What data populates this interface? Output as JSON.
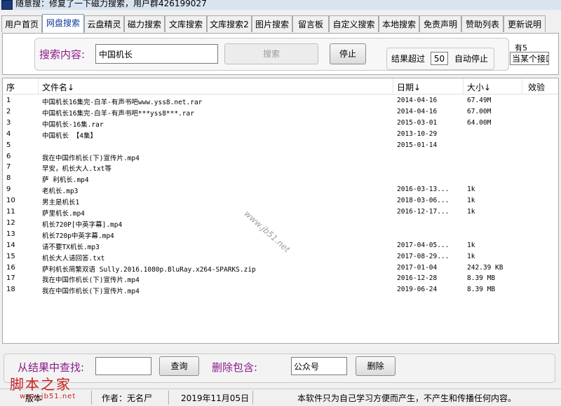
{
  "window": {
    "title": "随意搜：修复了一下磁力搜索，用户群426199027"
  },
  "tabs": [
    {
      "label": "用户首页"
    },
    {
      "label": "网盘搜索"
    },
    {
      "label": "云盘精灵"
    },
    {
      "label": "磁力搜索"
    },
    {
      "label": "文库搜索"
    },
    {
      "label": "文库搜索2"
    },
    {
      "label": "图片搜索"
    },
    {
      "label": "留言板"
    },
    {
      "label": "自定义搜索"
    },
    {
      "label": "本地搜索"
    },
    {
      "label": "免责声明"
    },
    {
      "label": "赞助列表"
    },
    {
      "label": "更新说明"
    }
  ],
  "search": {
    "label": "搜索内容:",
    "value": "中国机长",
    "search_button": "搜索",
    "stop_button": "停止",
    "limit_label": "结果超过",
    "limit_value": "50",
    "autostop_label": "自动停止",
    "count_label": "有5",
    "dropdown_value": "当某个接口"
  },
  "table": {
    "headers": {
      "idx": "序",
      "name": "文件名↓",
      "date": "日期↓",
      "size": "大小↓",
      "verify": "效验"
    },
    "rows": [
      {
        "idx": "1",
        "name": "中国机长16集完-白羊-有声书吧www.yss8.net.rar",
        "date": "2014-04-16",
        "size": "67.49M"
      },
      {
        "idx": "2",
        "name": "中国机长16集完-白羊-有声书吧***yss8***.rar",
        "date": "2014-04-16",
        "size": "67.00M"
      },
      {
        "idx": "3",
        "name": "中国机长-16集.rar",
        "date": "2015-03-01",
        "size": "64.00M"
      },
      {
        "idx": "4",
        "name": "中国机长 【4集】",
        "date": "2013-10-29",
        "size": ""
      },
      {
        "idx": "5",
        "name": "",
        "date": "2015-01-14",
        "size": ""
      },
      {
        "idx": "6",
        "name": "我在中国作机长(下)宣传片.mp4",
        "date": "",
        "size": ""
      },
      {
        "idx": "7",
        "name": "早安，机长大人.txt等",
        "date": "",
        "size": ""
      },
      {
        "idx": "8",
        "name": "萨 利机长.mp4",
        "date": "",
        "size": ""
      },
      {
        "idx": "9",
        "name": "老机长.mp3",
        "date": " 2016-03-13...",
        "size": "1k"
      },
      {
        "idx": "10",
        "name": "男主是机长1",
        "date": " 2018-03-06...",
        "size": "1k"
      },
      {
        "idx": "11",
        "name": "萨里机长.mp4",
        "date": " 2016-12-17...",
        "size": "1k"
      },
      {
        "idx": "12",
        "name": "机长720P[中英字幕].mp4",
        "date": "",
        "size": ""
      },
      {
        "idx": "13",
        "name": "机长720p中英字幕.mp4",
        "date": "",
        "size": ""
      },
      {
        "idx": "14",
        "name": "请不要TX机长.mp3",
        "date": "  2017-04-05...",
        "size": "1k"
      },
      {
        "idx": "15",
        "name": "机长大人请回答.txt",
        "date": "  2017-08-29...",
        "size": "1k"
      },
      {
        "idx": "16",
        "name": "萨利机长简繁双语 Sully.2016.1080p.BluRay.x264-SPARKS.zip",
        "date": "2017-01-04",
        "size": "242.39 KB"
      },
      {
        "idx": "17",
        "name": "我在中国作机长(下)宣传片.mp4",
        "date": "2016-12-28",
        "size": "8.39 MB"
      },
      {
        "idx": "18",
        "name": "我在中国作机长(下)宣传片.mp4",
        "date": "2019-06-24",
        "size": "8.39 MB"
      }
    ]
  },
  "filter": {
    "find_label": "从结果中查找:",
    "find_value": "",
    "query_button": "查询",
    "delete_label": "删除包含:",
    "delete_value": "公众号",
    "delete_button": "删除"
  },
  "status": {
    "version": "版本",
    "author": "作者：无名尸",
    "date": "2019年11月05日",
    "notice": "本软件只为自己学习方便而产生，不产生和传播任何内容。"
  },
  "watermark": {
    "logo": "脚本之家",
    "url": "www.jb51.net",
    "diagonal": "www.jb51.net"
  },
  "colors": {
    "label_purple": "#8b1a8b",
    "watermark_red": "#c81e1e",
    "active_tab_text": "#0a3a9a"
  }
}
